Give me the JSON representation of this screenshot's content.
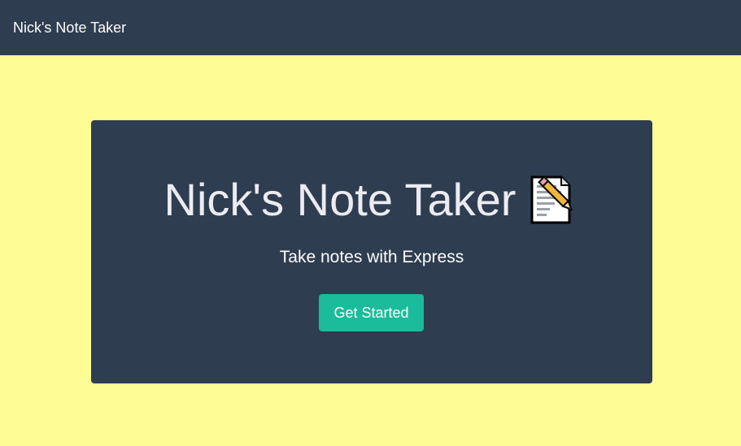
{
  "navbar": {
    "brand": "Nick's Note Taker"
  },
  "hero": {
    "title": "Nick's Note Taker",
    "title_icon": "memo-pencil-icon",
    "subtitle": "Take notes with Express",
    "button_label": "Get Started"
  },
  "colors": {
    "background": "#fdfc95",
    "navbar": "#2e3d50",
    "panel": "#2e3d50",
    "button": "#1abc9c"
  }
}
